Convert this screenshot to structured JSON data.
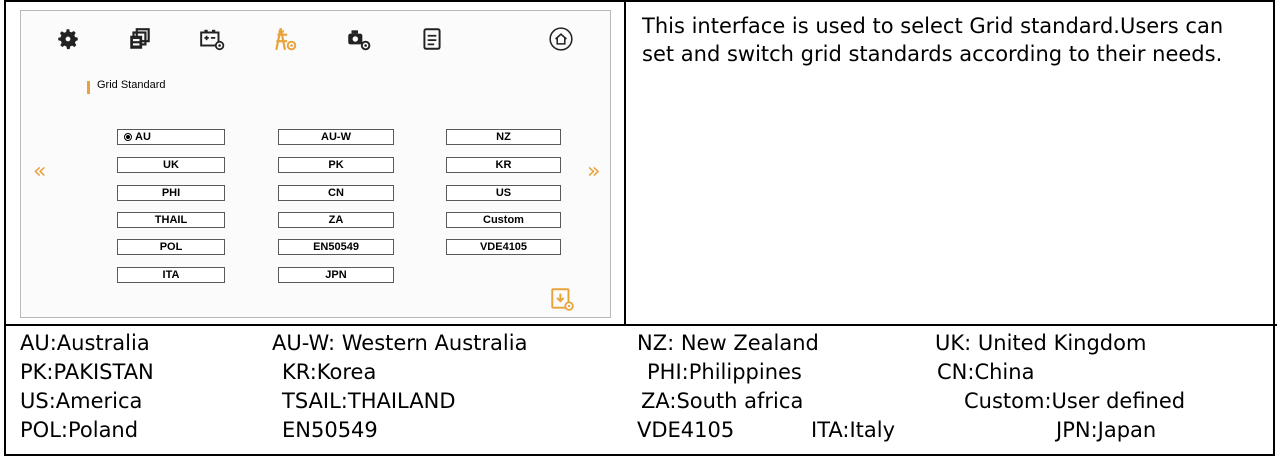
{
  "toolbar": {
    "icons": [
      "gear-icon",
      "copy-settings-icon",
      "battery-settings-icon",
      "grid-tower-icon",
      "generator-icon",
      "document-icon",
      "home-icon"
    ],
    "save_icon": "save-settings-icon"
  },
  "panel": {
    "title": "Grid Standard",
    "selected": "AU",
    "options": [
      "AU",
      "AU-W",
      "NZ",
      "UK",
      "PK",
      "KR",
      "PHI",
      "CN",
      "US",
      "THAIL",
      "ZA",
      "Custom",
      "POL",
      "EN50549",
      "VDE4105",
      "ITA",
      "JPN"
    ],
    "prev_arrow": "«",
    "next_arrow": "»"
  },
  "description": "This interface is used to select Grid standard.Users can set and switch  grid standards according to their needs.",
  "legend": [
    [
      "AU:Australia",
      "AU-W: Western Australia",
      "NZ: New Zealand",
      "UK: United Kingdom"
    ],
    [
      "PK:PAKISTAN",
      "KR:Korea",
      "PHI:Philippines",
      "CN:China"
    ],
    [
      "US:America",
      "TSAIL:THAILAND",
      "ZA:South africa",
      "Custom:User defined"
    ],
    [
      "POL:Poland",
      "EN50549",
      "VDE4105",
      "ITA:Italy",
      "JPN:Japan"
    ]
  ],
  "colors": {
    "accent": "#e8a33a",
    "border": "#000000"
  }
}
